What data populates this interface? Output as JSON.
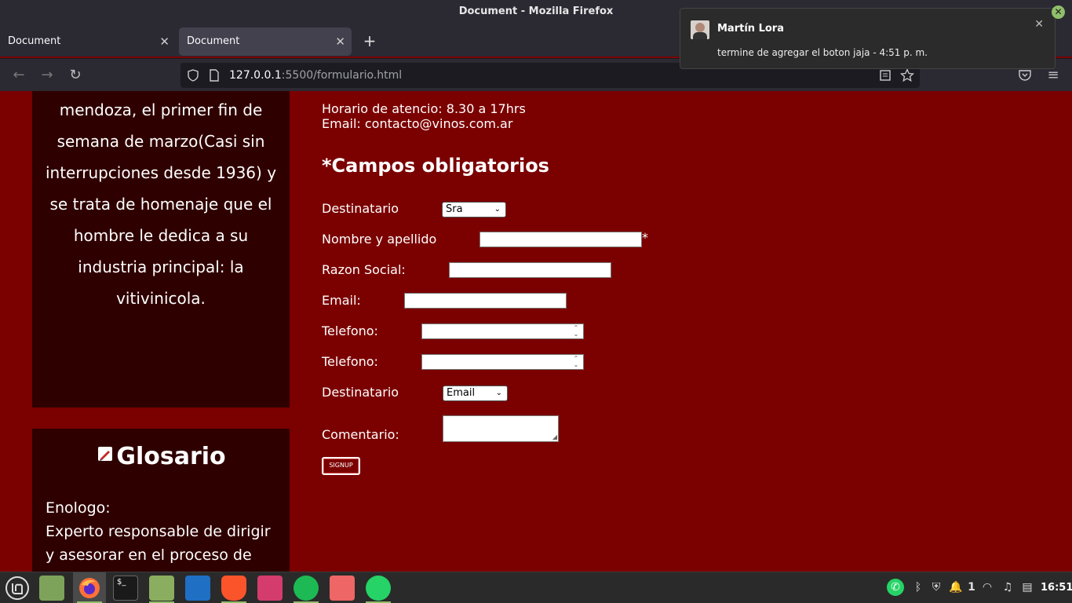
{
  "window": {
    "title": "Document - Mozilla Firefox"
  },
  "tabs": [
    {
      "label": "Document"
    },
    {
      "label": "Document"
    }
  ],
  "nav": {
    "url_host": "127.0.0.1",
    "url_rest": ":5500/formulario.html"
  },
  "left": {
    "history_text": "mendoza, el primer fin de semana de marzo(Casi sin interrupciones desde 1936) y se trata de homenaje que el hombre le dedica a su industria principal: la vitivinicola.",
    "glossary_title": "Glosario",
    "glossary_term": "Enologo:",
    "glossary_def": "Experto responsable de dirigir y asesorar en el proceso de"
  },
  "info": {
    "hours": "Horario de atencio: 8.30 a 17hrs",
    "email": "Email: contacto@vinos.com.ar"
  },
  "form": {
    "heading": "*Campos obligatorios",
    "dest_label": "Destinatario",
    "dest_value": "Sra",
    "name_label": "Nombre y apellido",
    "required_mark": "*",
    "razon_label": "Razon Social:",
    "email_label": "Email:",
    "tel1_label": "Telefono:",
    "tel2_label": "Telefono:",
    "dest2_label": "Destinatario",
    "dest2_value": "Email",
    "comment_label": "Comentario:",
    "signup_label": "SIGNUP"
  },
  "notification": {
    "sender": "Martín Lora",
    "message": "termine de agregar el boton jaja - 4:51 p. m."
  },
  "taskbar": {
    "workspace_count": "1",
    "clock": "16:51"
  }
}
